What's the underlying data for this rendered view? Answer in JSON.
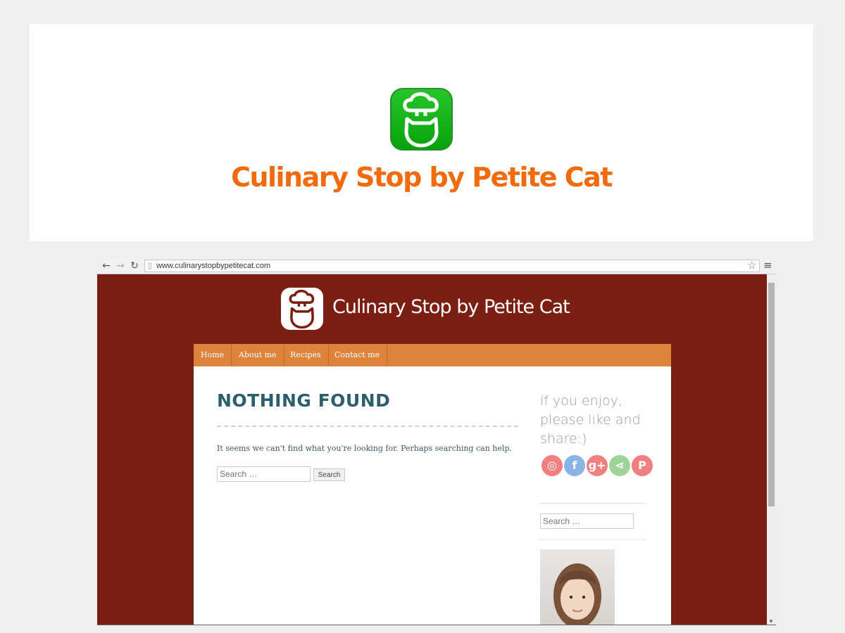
{
  "logo_panel": {
    "title": "Culinary Stop by Petite Cat",
    "icon": "chef-cat-icon",
    "title_color": "#f26a0e",
    "icon_color": "#09a80d"
  },
  "browser": {
    "url": "www.culinarystopbypetitecat.com",
    "icons": [
      "back-arrow-icon",
      "forward-arrow-icon",
      "reload-icon",
      "page-icon",
      "star-icon",
      "menu-icon"
    ]
  },
  "site": {
    "title": "Culinary Stop by Petite Cat",
    "background": "#7b1f12",
    "nav": [
      "Home",
      "About me",
      "Recipes",
      "Contact me"
    ],
    "nav_color": "#de833c"
  },
  "main": {
    "heading": "NOTHING FOUND",
    "message": "It seems we can't find what you're looking for. Perhaps searching can help.",
    "search_placeholder": "Search …",
    "search_button": "Search"
  },
  "sidebar": {
    "share_text": "if you enjoy, please like and share:)",
    "social_icons": [
      {
        "name": "weibo-icon",
        "glyph": "◎",
        "color": "#f08080"
      },
      {
        "name": "facebook-icon",
        "glyph": "f",
        "color": "#8bb4e6"
      },
      {
        "name": "googleplus-icon",
        "glyph": "g+",
        "color": "#f08080"
      },
      {
        "name": "share-icon",
        "glyph": "⋖",
        "color": "#9ed49a"
      },
      {
        "name": "pinterest-icon",
        "glyph": "P",
        "color": "#f08080"
      }
    ],
    "search_placeholder": "Search …"
  }
}
